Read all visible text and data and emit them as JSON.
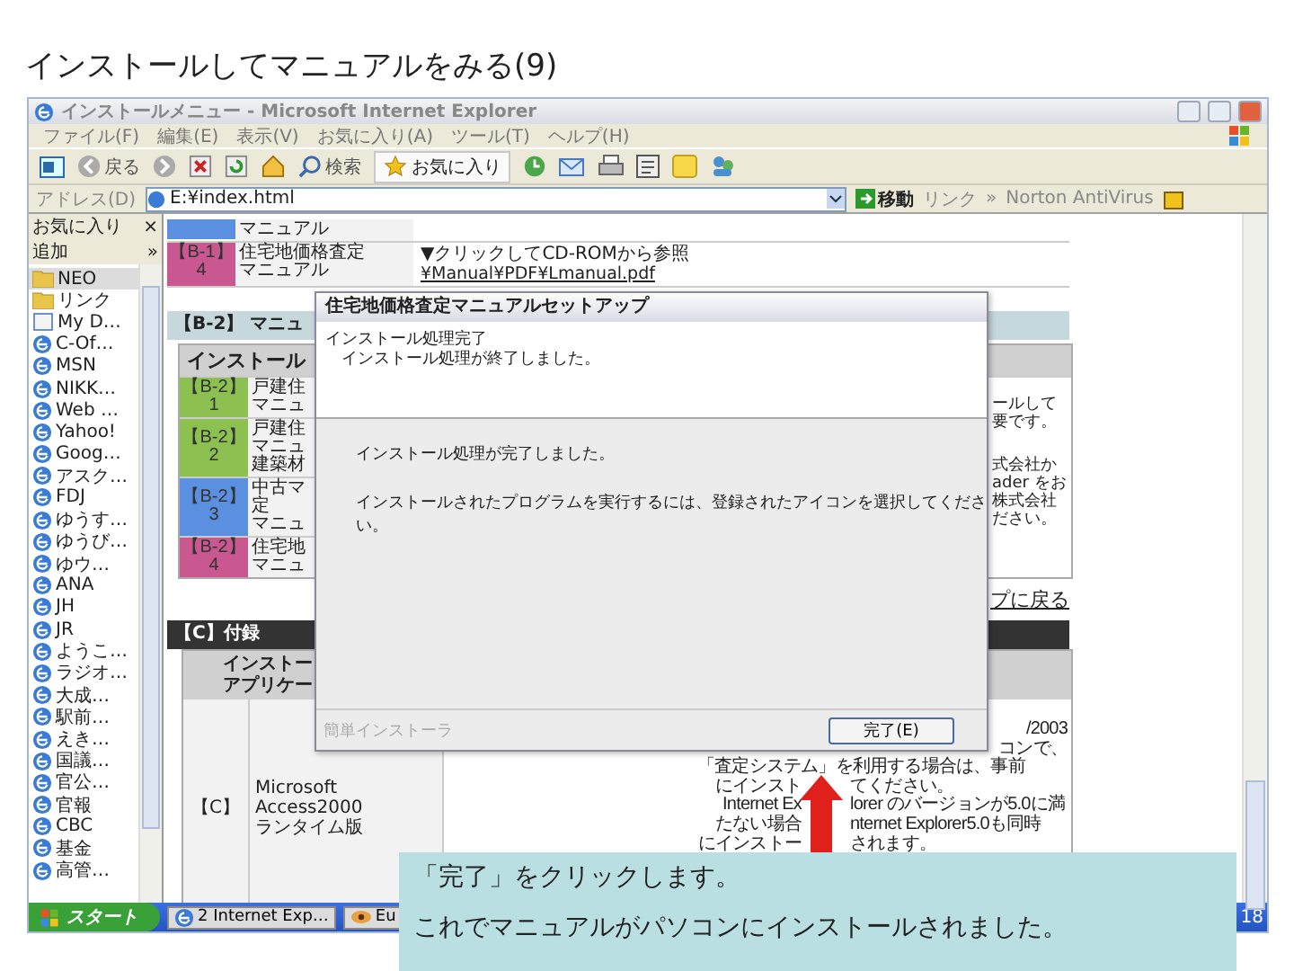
{
  "slide_title": "インストールしてマニュアルをみる(9)",
  "window": {
    "title": "インストールメニュー - Microsoft Internet Explorer"
  },
  "menu": [
    "ファイル(F)",
    "編集(E)",
    "表示(V)",
    "お気に入り(A)",
    "ツール(T)",
    "ヘルプ(H)"
  ],
  "toolbar": {
    "back": "戻る",
    "search": "検索",
    "favorites": "お気に入り"
  },
  "address_bar": {
    "label": "アドレス(D)",
    "value": "E:¥index.html",
    "go": "移動",
    "links": "リンク",
    "chevron": "»",
    "norton": "Norton AntiVirus"
  },
  "favorites_pane": {
    "title": "お気に入り",
    "close": "×",
    "add": "追加",
    "chevron": "»",
    "items": [
      {
        "label": "NEO",
        "kind": "folder",
        "selected": true
      },
      {
        "label": "リンク",
        "kind": "folder",
        "selected": false
      },
      {
        "label": "My D…",
        "kind": "page",
        "selected": false
      },
      {
        "label": "C-Of…",
        "kind": "ie",
        "selected": false
      },
      {
        "label": "MSN",
        "kind": "ie",
        "selected": false
      },
      {
        "label": "NIKK…",
        "kind": "ie",
        "selected": false
      },
      {
        "label": "Web …",
        "kind": "ie",
        "selected": false
      },
      {
        "label": "Yahoo!",
        "kind": "ie",
        "selected": false
      },
      {
        "label": "Goog…",
        "kind": "ie",
        "selected": false
      },
      {
        "label": "アスク…",
        "kind": "ie",
        "selected": false
      },
      {
        "label": "FDJ",
        "kind": "ie",
        "selected": false
      },
      {
        "label": "ゆうす…",
        "kind": "ie",
        "selected": false
      },
      {
        "label": "ゆうび…",
        "kind": "ie",
        "selected": false
      },
      {
        "label": "ゆウ…",
        "kind": "ie",
        "selected": false
      },
      {
        "label": "ANA",
        "kind": "ie",
        "selected": false
      },
      {
        "label": "JH",
        "kind": "ie",
        "selected": false
      },
      {
        "label": "JR",
        "kind": "ie",
        "selected": false
      },
      {
        "label": "ようこ…",
        "kind": "ie",
        "selected": false
      },
      {
        "label": "ラジオ…",
        "kind": "ie",
        "selected": false
      },
      {
        "label": "大成…",
        "kind": "ie",
        "selected": false
      },
      {
        "label": "駅前…",
        "kind": "ie",
        "selected": false
      },
      {
        "label": "えき…",
        "kind": "ie",
        "selected": false
      },
      {
        "label": "国議…",
        "kind": "ie",
        "selected": false
      },
      {
        "label": "官公…",
        "kind": "ie",
        "selected": false
      },
      {
        "label": "官報",
        "kind": "ie",
        "selected": false
      },
      {
        "label": "CBC",
        "kind": "ie",
        "selected": false
      },
      {
        "label": "基金",
        "kind": "ie",
        "selected": false
      },
      {
        "label": "高管…",
        "kind": "ie",
        "selected": false
      }
    ]
  },
  "content": {
    "top_rows": [
      {
        "color": "#5b8fe0",
        "lines": [
          "マニュアル"
        ],
        "note": []
      },
      {
        "code": "【B-1】",
        "number": "4",
        "color": "#c8588f",
        "lines": [
          "住宅地価格査定",
          "マニュアル"
        ],
        "note": [
          "▼クリックしてCD-ROMから参照",
          "¥Manual¥PDF¥Lmanual.pdf"
        ]
      }
    ],
    "section_b2": {
      "title": "【B-2】 マニュ",
      "header": "インストール",
      "rows": [
        {
          "code": "【B-2】",
          "number": "1",
          "color": "#8cc152",
          "lines": [
            "戸建住",
            "マニュ"
          ]
        },
        {
          "code": "【B-2】",
          "number": "2",
          "color": "#8cc152",
          "lines": [
            "戸建住",
            "マニュ",
            "建築材"
          ]
        },
        {
          "code": "【B-2】",
          "number": "3",
          "color": "#5b8fe0",
          "lines": [
            "中古マ",
            "定",
            "マニュ"
          ]
        },
        {
          "code": "【B-2】",
          "number": "4",
          "color": "#c8588f",
          "lines": [
            "住宅地",
            "マニュ"
          ]
        }
      ],
      "side_notes": [
        [
          "ールして",
          "要です。"
        ],
        [
          "式会社か",
          "ader をお",
          "株式会社",
          "ださい。"
        ]
      ],
      "back_link": "プに戻る"
    },
    "section_c": {
      "title": "【C】付録",
      "header": [
        "インストー",
        "アプリケー"
      ],
      "code": "【C】",
      "name": [
        "Microsoft Access2000",
        "ランタイム版"
      ],
      "notes": [
        {
          "kind": "right",
          "text": "/2003"
        },
        {
          "kind": "right",
          "text": "コンで、"
        },
        {
          "kind": "full",
          "text": "「査定システム」を利用する場合は、事前"
        },
        {
          "kind": "split",
          "left": "にインスト",
          "right": "てください。"
        },
        {
          "kind": "split",
          "left": "Internet Ex",
          "right": "lorer のバージョンが5.0に満"
        },
        {
          "kind": "split",
          "left": "たない場合",
          "right": "nternet Explorer5.0も同時"
        },
        {
          "kind": "split",
          "left": "にインストー",
          "right": "されます。"
        }
      ]
    }
  },
  "dialog": {
    "title": "住宅地価格査定マニュアルセットアップ",
    "heading": "インストール処理完了",
    "subheading": "インストール処理が終了しました。",
    "messages": [
      "インストール処理が完了しました。",
      "インストールされたプログラムを実行するには、登録されたアイコンを選択してください。"
    ],
    "footer": "簡単インストーラ",
    "button": "完了(E)"
  },
  "callout": {
    "lines": [
      "「完了」をクリックします。",
      "これでマニュアルがパソコンにインストールされました。"
    ]
  },
  "taskbar": {
    "start": "スタート",
    "tasks": [
      {
        "label": "2 Internet Exp…",
        "kind": "ie"
      },
      {
        "label": "Eu",
        "kind": "app"
      }
    ],
    "clock": "18"
  }
}
